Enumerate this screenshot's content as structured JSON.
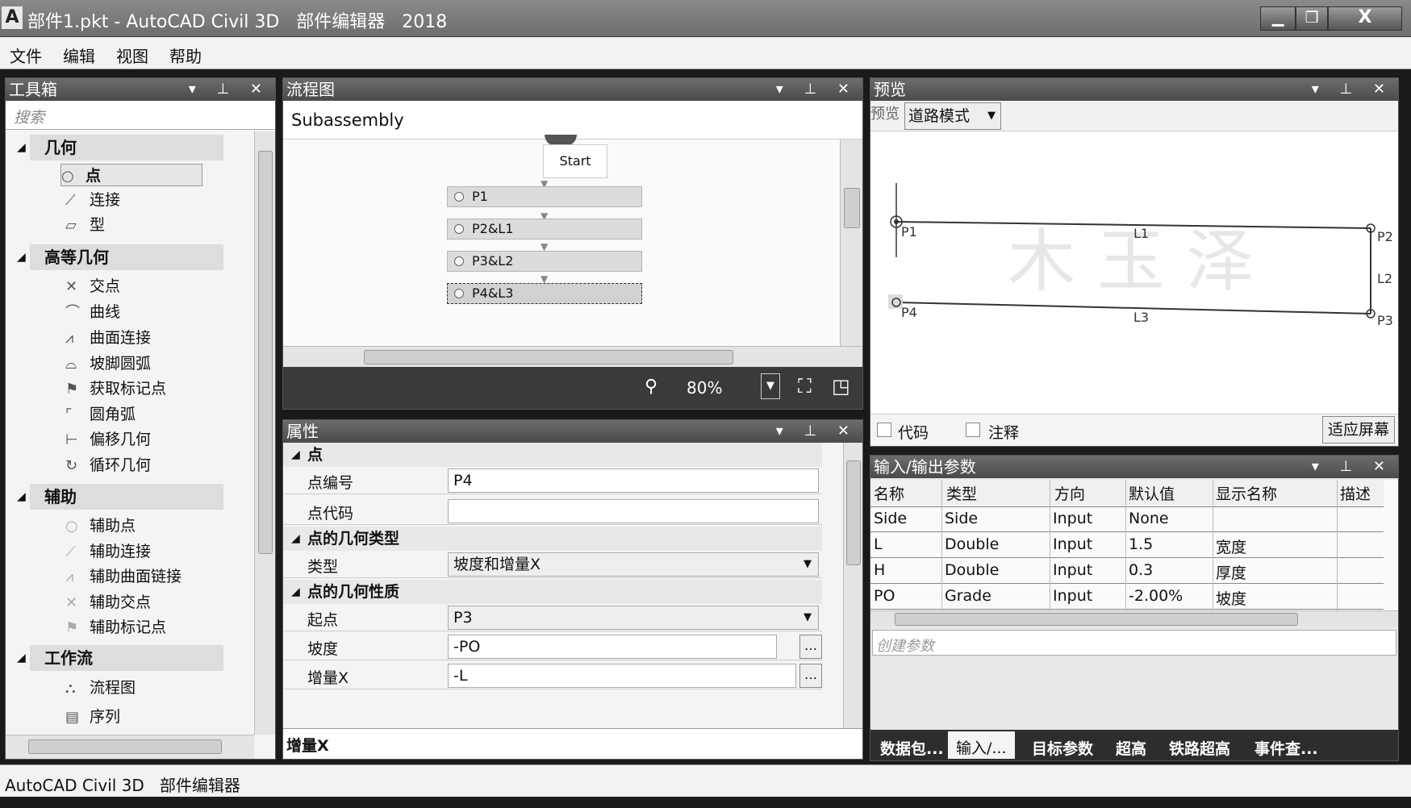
{
  "window": {
    "title": "部件1.pkt - AutoCAD Civil 3D   部件编辑器   2018",
    "app_icon": "A",
    "minimize": "▁",
    "restore": "❐",
    "close": "X"
  },
  "menu": [
    "文件",
    "编辑",
    "视图",
    "帮助"
  ],
  "toolbox": {
    "title": "工具箱",
    "search_placeholder": "搜索",
    "groups": [
      {
        "label": "几何",
        "items": [
          "点",
          "连接",
          "型"
        ]
      },
      {
        "label": "高等几何",
        "items": [
          "交点",
          "曲线",
          "曲面连接",
          "坡脚圆弧",
          "获取标记点",
          "圆角弧",
          "偏移几何",
          "循环几何"
        ]
      },
      {
        "label": "辅助",
        "items": [
          "辅助点",
          "辅助连接",
          "辅助曲面链接",
          "辅助交点",
          "辅助标记点"
        ]
      },
      {
        "label": "工作流",
        "items": [
          "流程图",
          "序列"
        ]
      }
    ]
  },
  "flowchart": {
    "title": "流程图",
    "header": "Subassembly",
    "start_label": "Start",
    "nodes": [
      "P1",
      "P2&L1",
      "P3&L2",
      "P4&L3"
    ],
    "zoom": "80%"
  },
  "properties": {
    "title": "属性",
    "cat_point": "点",
    "point_number_label": "点编号",
    "point_number_value": "P4",
    "point_code_label": "点代码",
    "point_code_value": "",
    "cat_geom_type": "点的几何类型",
    "type_label": "类型",
    "type_value": "坡度和增量X",
    "cat_geom_props": "点的几何性质",
    "from_label": "起点",
    "from_value": "P3",
    "slope_label": "坡度",
    "slope_value": "-PO",
    "deltax_label": "增量X",
    "deltax_value": "-L",
    "footer_label": "增量X"
  },
  "preview": {
    "title": "预览",
    "mode_label": "预览",
    "mode_value": "道路模式",
    "watermark": "木 玉 泽",
    "labels": {
      "p1": "P1",
      "p2": "P2",
      "p3": "P3",
      "p4": "P4",
      "l1": "L1",
      "l2": "L2",
      "l3": "L3"
    },
    "codes_label": "代码",
    "annotations_label": "注释",
    "fit_button": "适应屏幕"
  },
  "params": {
    "title": "输入/输出参数",
    "columns": [
      "名称",
      "类型",
      "方向",
      "默认值",
      "显示名称",
      "描述"
    ],
    "rows": [
      [
        "Side",
        "Side",
        "Input",
        "None",
        "",
        ""
      ],
      [
        "L",
        "Double",
        "Input",
        "1.5",
        "宽度",
        ""
      ],
      [
        "H",
        "Double",
        "Input",
        "0.3",
        "厚度",
        ""
      ],
      [
        "PO",
        "Grade",
        "Input",
        "-2.00%",
        "坡度",
        ""
      ]
    ],
    "create_placeholder": "创建参数",
    "tabs": [
      "数据包...",
      "输入/...",
      "目标参数",
      "超高",
      "铁路超高",
      "事件查..."
    ]
  },
  "statusbar": {
    "text": "AutoCAD Civil 3D   部件编辑器"
  }
}
